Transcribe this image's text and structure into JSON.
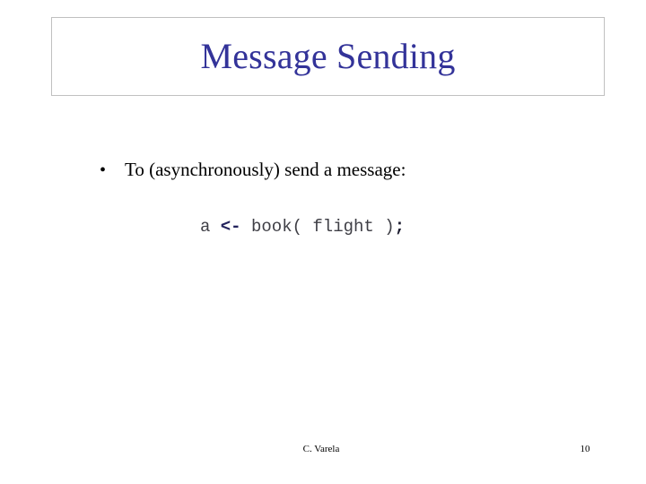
{
  "slide": {
    "background_color": "#ffffff",
    "title": {
      "text": "Message Sending",
      "color": "#333399",
      "border_color": "#c0c0c0"
    },
    "body": {
      "bullets": [
        {
          "marker": "•",
          "text": "To (asynchronously) send a message:"
        }
      ],
      "code": {
        "full_text": "a <- book( flight );",
        "tokens": [
          {
            "text": "a ",
            "style": "plain"
          },
          {
            "text": "<-",
            "style": "arrow"
          },
          {
            "text": " book( flight )",
            "style": "plain"
          },
          {
            "text": ";",
            "style": "semi"
          }
        ]
      }
    },
    "footer": {
      "author": "C. Varela",
      "page_number": "10"
    }
  }
}
